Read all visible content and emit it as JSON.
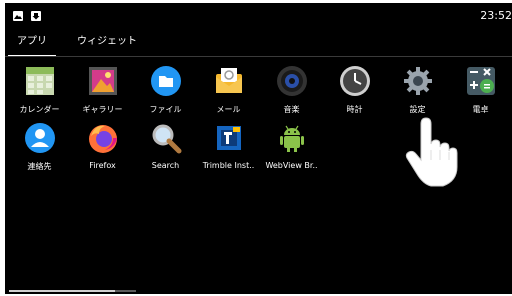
{
  "status_bar": {
    "time": "23:52",
    "icons": [
      "image-icon",
      "download-icon"
    ]
  },
  "tabs": [
    {
      "label": "アプリ",
      "active": true
    },
    {
      "label": "ウィジェット",
      "active": false
    }
  ],
  "apps": [
    {
      "label": "カレンダー",
      "icon": "calendar-icon"
    },
    {
      "label": "ギャラリー",
      "icon": "gallery-icon"
    },
    {
      "label": "ファイル",
      "icon": "files-icon"
    },
    {
      "label": "メール",
      "icon": "mail-icon"
    },
    {
      "label": "音楽",
      "icon": "music-icon"
    },
    {
      "label": "時計",
      "icon": "clock-icon"
    },
    {
      "label": "設定",
      "icon": "settings-icon"
    },
    {
      "label": "電卓",
      "icon": "calculator-icon"
    },
    {
      "label": "連絡先",
      "icon": "contacts-icon"
    },
    {
      "label": "Firefox",
      "icon": "firefox-icon"
    },
    {
      "label": "Search",
      "icon": "search-icon"
    },
    {
      "label": "Trimble Inst..",
      "icon": "trimble-icon"
    },
    {
      "label": "WebView Br..",
      "icon": "android-icon"
    }
  ],
  "colors": {
    "background": "#000000",
    "text": "#ffffff",
    "files_blue": "#2196f3",
    "mail_yellow": "#f5b82e",
    "calculator_green": "#4caf50",
    "contacts_blue": "#2196f3"
  }
}
